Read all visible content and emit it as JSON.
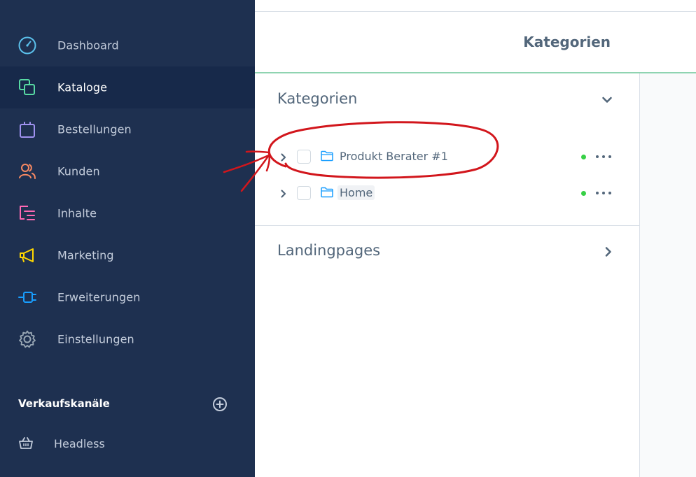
{
  "sidebar": {
    "items": [
      {
        "label": "Dashboard",
        "icon": "dashboard-icon",
        "color": "#5bc0eb"
      },
      {
        "label": "Kataloge",
        "icon": "catalog-icon",
        "color": "#57d9a3",
        "active": true
      },
      {
        "label": "Bestellungen",
        "icon": "shopping-bag-icon",
        "color": "#a092f0"
      },
      {
        "label": "Kunden",
        "icon": "users-icon",
        "color": "#f88962"
      },
      {
        "label": "Inhalte",
        "icon": "content-icon",
        "color": "#ff68b4"
      },
      {
        "label": "Marketing",
        "icon": "megaphone-icon",
        "color": "#ffd700"
      },
      {
        "label": "Erweiterungen",
        "icon": "plug-icon",
        "color": "#189eff"
      },
      {
        "label": "Einstellungen",
        "icon": "gear-icon",
        "color": "#9aa8b5"
      }
    ],
    "sales_channels_title": "Verkaufskanäle",
    "channels": [
      {
        "label": "Headless",
        "icon": "basket-icon"
      }
    ]
  },
  "header": {
    "title": "Kategorien"
  },
  "categories_card": {
    "title": "Kategorien",
    "tree": [
      {
        "label": "Produkt Berater #1",
        "status": "active"
      },
      {
        "label": "Home",
        "status": "active"
      }
    ]
  },
  "landingpages_card": {
    "title": "Landingpages"
  },
  "colors": {
    "sidebar_bg": "#1e3050",
    "sidebar_active_bg": "#17294a",
    "accent_line": "#8fd4b1",
    "status_active": "#37d046",
    "annotation": "#d2161c"
  }
}
